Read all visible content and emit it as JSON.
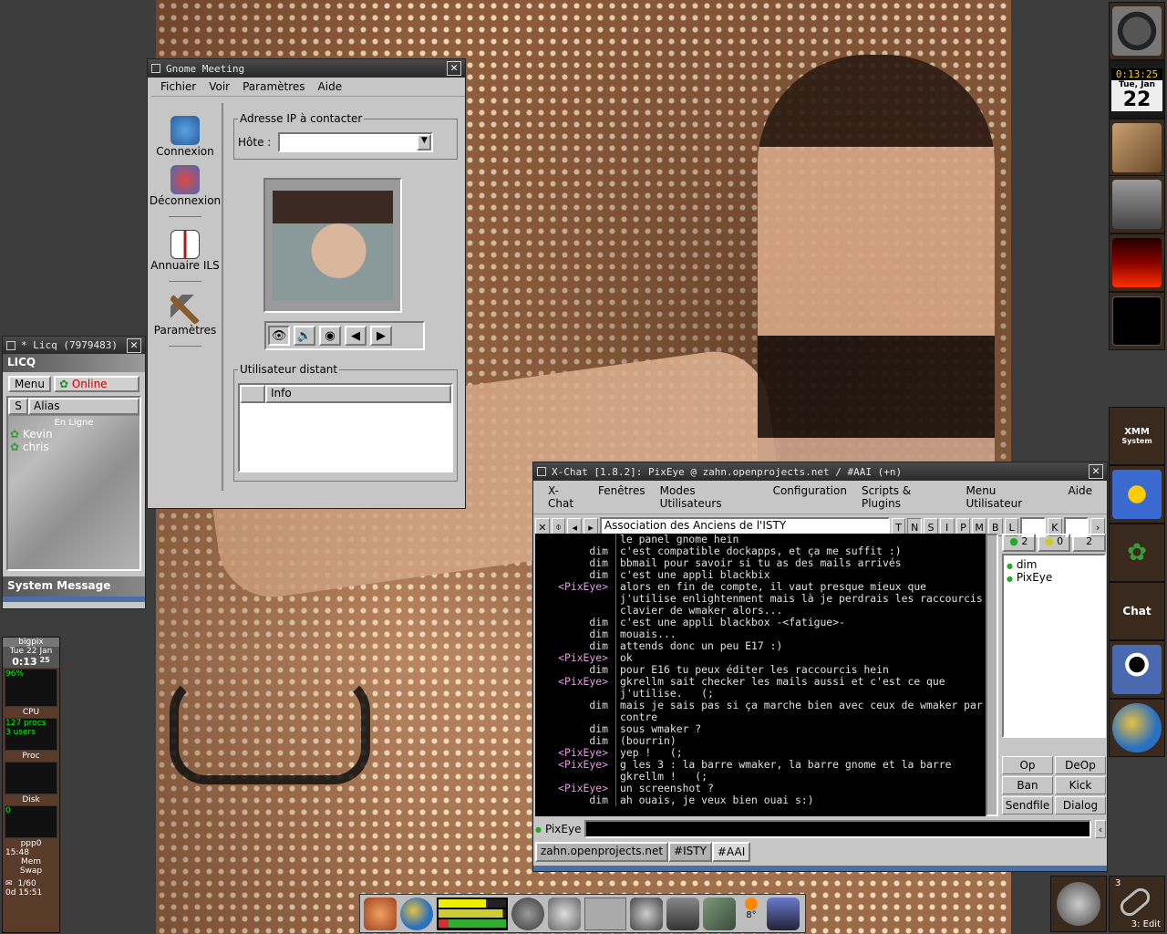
{
  "gnome_meeting": {
    "title": "Gnome Meeting",
    "menu": [
      "Fichier",
      "Voir",
      "Paramètres",
      "Aide"
    ],
    "sidebar": [
      {
        "label": "Connexion",
        "icon": "phone-icon"
      },
      {
        "label": "Déconnexion",
        "icon": "hangup-icon"
      },
      {
        "label": "Annuaire ILS",
        "icon": "book-icon"
      },
      {
        "label": "Paramètres",
        "icon": "hammer-icon"
      }
    ],
    "address_group": "Adresse IP à contacter",
    "host_label": "Hôte :",
    "host_value": "",
    "remote_group": "Utilisateur distant",
    "remote_column": "Info"
  },
  "licq": {
    "title": "* Licq (7979483)",
    "brand": "LICQ",
    "menu_button": "Menu",
    "status": "Online",
    "col_s": "S",
    "col_alias": "Alias",
    "group": "En Ligne",
    "contacts": [
      "Kevin",
      "chris"
    ],
    "system_message": "System Message"
  },
  "xchat": {
    "title": "X-Chat [1.8.2]: PixEye @ zahn.openprojects.net / #AAI (+n)",
    "menu": [
      "X-Chat",
      "Fenêtres",
      "Modes Utilisateurs",
      "Configuration",
      "Scripts & Plugins",
      "Menu Utilisateur",
      "Aide"
    ],
    "topic": "Association des Anciens de l'ISTY",
    "mode_buttons": [
      "T",
      "N",
      "S",
      "I",
      "P",
      "M",
      "B",
      "L"
    ],
    "key_button": "K",
    "counts": {
      "ops": "2",
      "voice": "0",
      "total": "2"
    },
    "users": [
      "dim",
      "PixEye"
    ],
    "actions": [
      "Op",
      "DeOp",
      "Ban",
      "Kick",
      "Sendfile",
      "Dialog"
    ],
    "nick": "PixEye",
    "input_value": "",
    "tabs": [
      "zahn.openprojects.net",
      "#ISTY",
      "#AAI"
    ],
    "messages": [
      {
        "nick": "",
        "text": "le panel gnome hein"
      },
      {
        "nick": "dim",
        "text": "c'est compatible dockapps, et ça me suffit :)"
      },
      {
        "nick": "dim",
        "text": "bbmail pour savoir si tu as des mails arrivés"
      },
      {
        "nick": "dim",
        "text": "c'est une appli blackbix"
      },
      {
        "nick": "<PixEye>",
        "text": "alors en fin de compte, il vaut presque mieux que j'utilise enlightenment mais là je perdrais les raccourcis clavier de wmaker alors..."
      },
      {
        "nick": "dim",
        "text": "c'est une appli blackbox -<fatigue>-"
      },
      {
        "nick": "dim",
        "text": "mouais..."
      },
      {
        "nick": "dim",
        "text": "attends donc un peu E17 :)"
      },
      {
        "nick": "<PixEye>",
        "text": "ok"
      },
      {
        "nick": "dim",
        "text": "pour E16 tu peux éditer les raccourcis hein"
      },
      {
        "nick": "<PixEye>",
        "text": "gkrellm sait checker les mails aussi et c'est ce que j'utilise.   (;"
      },
      {
        "nick": "dim",
        "text": "mais je sais pas si ça marche bien avec ceux de wmaker par contre"
      },
      {
        "nick": "dim",
        "text": "sous wmaker ?"
      },
      {
        "nick": "dim",
        "text": "(bourrin)"
      },
      {
        "nick": "<PixEye>",
        "text": "yep !   (;"
      },
      {
        "nick": "<PixEye>",
        "text": "g les 3 : la barre wmaker, la barre gnome et la barre gkrellm !   (;"
      },
      {
        "nick": "<PixEye>",
        "text": "un screenshot ?"
      },
      {
        "nick": "dim",
        "text": "ah ouais, je veux bien ouai s:)"
      }
    ]
  },
  "dock": {
    "time": "0:13:25",
    "day": "Tue, Jan",
    "date": "22",
    "app_labels": [
      "XMM",
      "System",
      "Chat"
    ]
  },
  "gkrellm": {
    "host": "bigpix",
    "day": "Tue",
    "date": "22",
    "month": "Jan",
    "time": "0:13",
    "seconds": "25",
    "cpu_pct": "96%",
    "cpu": "CPU",
    "procs": "127 procs",
    "users": "3 users",
    "proc": "Proc",
    "disk": "Disk",
    "disk_val": "0",
    "net": "ppp0",
    "net_time": "15:48",
    "mem": "Mem",
    "swap": "Swap",
    "mail": "1/60",
    "uptime": "0d 15:51"
  },
  "panel": {
    "temp": "8°"
  },
  "workspace": {
    "num": "3",
    "label": "3: Edit"
  }
}
